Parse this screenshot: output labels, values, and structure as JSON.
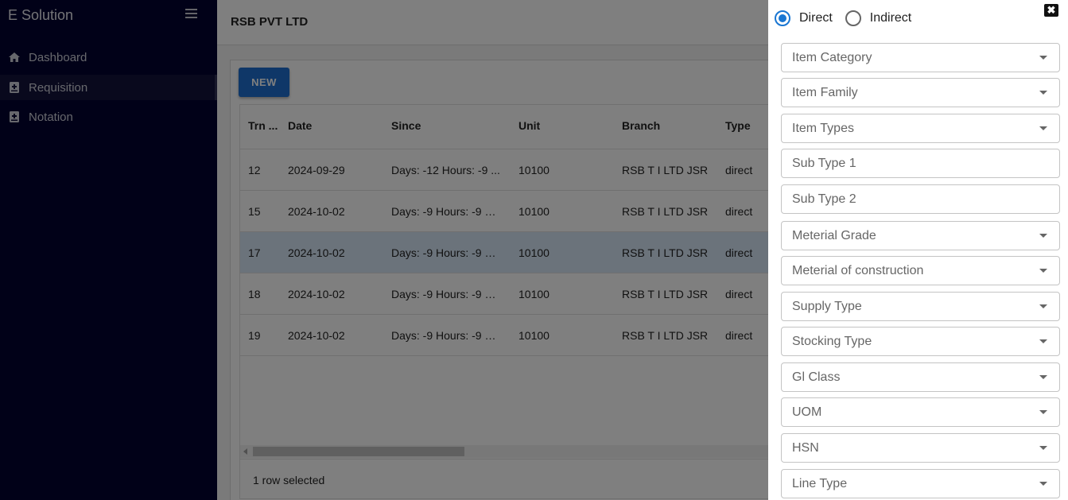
{
  "sidebar": {
    "brand": "E Solution",
    "items": [
      {
        "label": "Dashboard",
        "icon": "home-icon"
      },
      {
        "label": "Requisition",
        "icon": "requisition-icon",
        "active": true
      },
      {
        "label": "Notation",
        "icon": "notation-icon"
      }
    ]
  },
  "header": {
    "company": "RSB PVT LTD"
  },
  "toolbar": {
    "new_label": "NEW"
  },
  "grid": {
    "columns": [
      "Trn ...",
      "Date",
      "Since",
      "Unit",
      "Branch",
      "Type"
    ],
    "rows": [
      {
        "trn": "12",
        "date": "2024-09-29",
        "since": "Days: -12 Hours: -9 ...",
        "unit": "10100",
        "branch": "RSB T I LTD JSR",
        "type": "direct"
      },
      {
        "trn": "15",
        "date": "2024-10-02",
        "since": "Days: -9 Hours: -9 m...",
        "unit": "10100",
        "branch": "RSB T I LTD JSR",
        "type": "direct"
      },
      {
        "trn": "17",
        "date": "2024-10-02",
        "since": "Days: -9 Hours: -9 m...",
        "unit": "10100",
        "branch": "RSB T I LTD JSR",
        "type": "direct",
        "selected": true
      },
      {
        "trn": "18",
        "date": "2024-10-02",
        "since": "Days: -9 Hours: -9 m...",
        "unit": "10100",
        "branch": "RSB T I LTD JSR",
        "type": "direct"
      },
      {
        "trn": "19",
        "date": "2024-10-02",
        "since": "Days: -9 Hours: -9 m...",
        "unit": "10100",
        "branch": "RSB T I LTD JSR",
        "type": "direct"
      }
    ],
    "footer": "1 row selected"
  },
  "drawer": {
    "close_icon": "close-icon",
    "radio": {
      "direct": "Direct",
      "indirect": "Indirect",
      "selected": "Direct"
    },
    "fields": {
      "item_category": "Item Category",
      "item_family": "Item Family",
      "item_types": "Item Types",
      "sub_type_1": "Sub Type 1",
      "sub_type_2": "Sub Type 2",
      "meterial_grade": "Meterial Grade",
      "meterial_construction": "Meterial of construction",
      "supply_type": "Supply Type",
      "stocking_type": "Stocking Type",
      "gl_class": "Gl Class",
      "uom": "UOM",
      "hsn": "HSN",
      "line_type": "Line Type"
    }
  },
  "colors": {
    "sidebar_bg": "#020230",
    "accent": "#1976d2",
    "new_button": "#1f6fd1",
    "selected_row": "#d6e6f7"
  }
}
